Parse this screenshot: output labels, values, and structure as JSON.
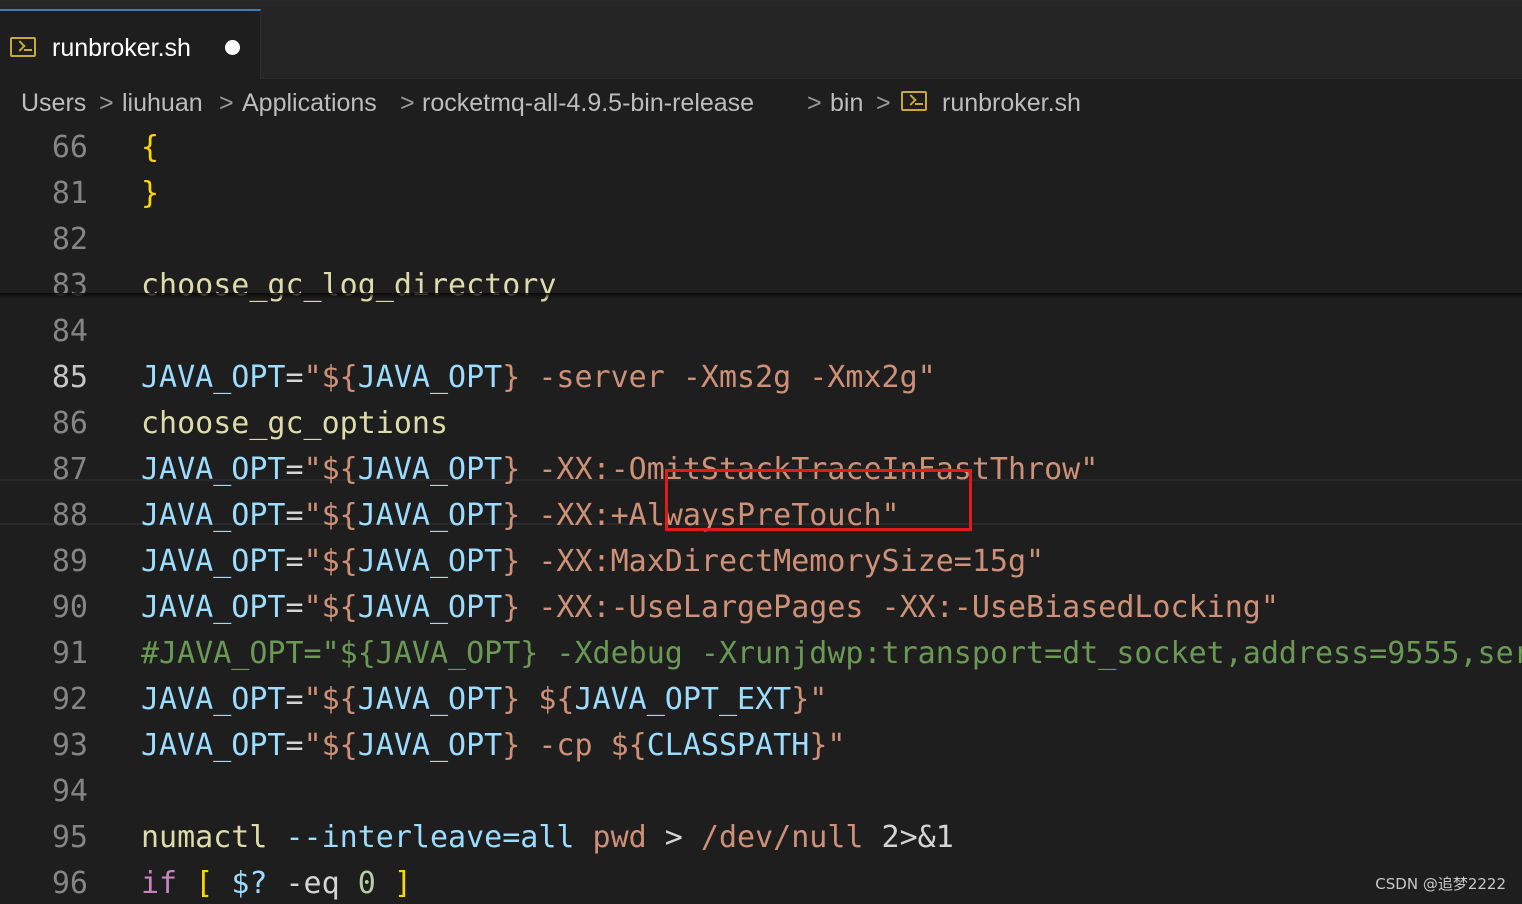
{
  "tab": {
    "label": "runbroker.sh",
    "icon": "terminal-file-icon",
    "modified": true
  },
  "breadcrumb": {
    "items": [
      "Users",
      "liuhuan",
      "Applications",
      "rocketmq-all-4.9.5-bin-release",
      "bin",
      "runbroker.sh"
    ],
    "separator": ">"
  },
  "editor": {
    "active_line": "85",
    "lines": [
      {
        "n": "66",
        "tokens": [
          {
            "t": "{",
            "c": "brace"
          }
        ]
      },
      {
        "n": "81",
        "tokens": [
          {
            "t": "}",
            "c": "brace"
          }
        ]
      },
      {
        "n": "82",
        "tokens": []
      },
      {
        "n": "83",
        "tokens": [
          {
            "t": "choose_gc_log_directory",
            "c": "cmd"
          }
        ]
      },
      {
        "n": "84",
        "tokens": []
      },
      {
        "n": "85",
        "tokens": [
          {
            "t": "JAVA_OPT",
            "c": "var"
          },
          {
            "t": "=",
            "c": "plain"
          },
          {
            "t": "\"",
            "c": "str"
          },
          {
            "t": "${",
            "c": "str"
          },
          {
            "t": "JAVA_OPT",
            "c": "var"
          },
          {
            "t": "}",
            "c": "str"
          },
          {
            "t": " -server -Xms2g -Xmx2g\"",
            "c": "str"
          }
        ]
      },
      {
        "n": "86",
        "tokens": [
          {
            "t": "choose_gc_options",
            "c": "cmd"
          }
        ]
      },
      {
        "n": "87",
        "tokens": [
          {
            "t": "JAVA_OPT",
            "c": "var"
          },
          {
            "t": "=",
            "c": "plain"
          },
          {
            "t": "\"${",
            "c": "str"
          },
          {
            "t": "JAVA_OPT",
            "c": "var"
          },
          {
            "t": "} -XX:-OmitStackTraceInFastThrow\"",
            "c": "str"
          }
        ]
      },
      {
        "n": "88",
        "tokens": [
          {
            "t": "JAVA_OPT",
            "c": "var"
          },
          {
            "t": "=",
            "c": "plain"
          },
          {
            "t": "\"${",
            "c": "str"
          },
          {
            "t": "JAVA_OPT",
            "c": "var"
          },
          {
            "t": "} -XX:+AlwaysPreTouch\"",
            "c": "str"
          }
        ]
      },
      {
        "n": "89",
        "tokens": [
          {
            "t": "JAVA_OPT",
            "c": "var"
          },
          {
            "t": "=",
            "c": "plain"
          },
          {
            "t": "\"${",
            "c": "str"
          },
          {
            "t": "JAVA_OPT",
            "c": "var"
          },
          {
            "t": "} -XX:MaxDirectMemorySize=15g\"",
            "c": "str"
          }
        ]
      },
      {
        "n": "90",
        "tokens": [
          {
            "t": "JAVA_OPT",
            "c": "var"
          },
          {
            "t": "=",
            "c": "plain"
          },
          {
            "t": "\"${",
            "c": "str"
          },
          {
            "t": "JAVA_OPT",
            "c": "var"
          },
          {
            "t": "} -XX:-UseLargePages -XX:-UseBiasedLocking\"",
            "c": "str"
          }
        ]
      },
      {
        "n": "91",
        "tokens": [
          {
            "t": "#JAVA_OPT=\"${JAVA_OPT} -Xdebug -Xrunjdwp:transport=dt_socket,address=9555,ser",
            "c": "cmt"
          }
        ]
      },
      {
        "n": "92",
        "tokens": [
          {
            "t": "JAVA_OPT",
            "c": "var"
          },
          {
            "t": "=",
            "c": "plain"
          },
          {
            "t": "\"${",
            "c": "str"
          },
          {
            "t": "JAVA_OPT",
            "c": "var"
          },
          {
            "t": "} ${",
            "c": "str"
          },
          {
            "t": "JAVA_OPT_EXT",
            "c": "var"
          },
          {
            "t": "}\"",
            "c": "str"
          }
        ]
      },
      {
        "n": "93",
        "tokens": [
          {
            "t": "JAVA_OPT",
            "c": "var"
          },
          {
            "t": "=",
            "c": "plain"
          },
          {
            "t": "\"${",
            "c": "str"
          },
          {
            "t": "JAVA_OPT",
            "c": "var"
          },
          {
            "t": "} -cp ${",
            "c": "str"
          },
          {
            "t": "CLASSPATH",
            "c": "var"
          },
          {
            "t": "}\"",
            "c": "str"
          }
        ]
      },
      {
        "n": "94",
        "tokens": []
      },
      {
        "n": "95",
        "tokens": [
          {
            "t": "numactl",
            "c": "cmd"
          },
          {
            "t": " ",
            "c": "plain"
          },
          {
            "t": "--interleave=all",
            "c": "var"
          },
          {
            "t": " ",
            "c": "plain"
          },
          {
            "t": "pwd",
            "c": "str"
          },
          {
            "t": " > ",
            "c": "plain"
          },
          {
            "t": "/dev/null",
            "c": "str"
          },
          {
            "t": " 2>&1",
            "c": "plain"
          }
        ]
      },
      {
        "n": "96",
        "tokens": [
          {
            "t": "if",
            "c": "kw"
          },
          {
            "t": " ",
            "c": "plain"
          },
          {
            "t": "[",
            "c": "brace"
          },
          {
            "t": " ",
            "c": "plain"
          },
          {
            "t": "$?",
            "c": "var"
          },
          {
            "t": " -eq ",
            "c": "plain"
          },
          {
            "t": "0",
            "c": "num"
          },
          {
            "t": " ",
            "c": "plain"
          },
          {
            "t": "]",
            "c": "brace"
          }
        ]
      }
    ]
  },
  "annotation": {
    "color": "#e01b1b",
    "target": "-Xms2g -Xmx2g\""
  },
  "watermark": "CSDN @追梦2222"
}
